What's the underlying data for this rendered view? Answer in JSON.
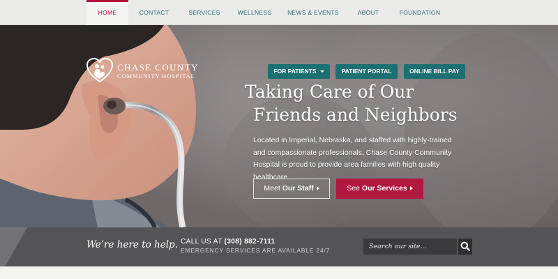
{
  "nav": {
    "items": [
      {
        "label": "HOME"
      },
      {
        "label": "CONTACT"
      },
      {
        "label": "SERVICES"
      },
      {
        "label": "WELLNESS"
      },
      {
        "label": "NEWS & EVENTS"
      },
      {
        "label": "ABOUT"
      },
      {
        "label": "FOUNDATION"
      }
    ],
    "active": "HOME"
  },
  "logo": {
    "line1": "CHASE COUNTY",
    "line2": "COMMUNITY HOSPITAL",
    "icon": "heart-family-icon"
  },
  "header_buttons": {
    "for_patients": "FOR PATIENTS",
    "patient_portal": "PATIENT PORTAL",
    "online_bill_pay": "ONLINE BILL PAY"
  },
  "hero": {
    "headline_line1": "Taking Care of Our",
    "headline_line2": "Friends and Neighbors",
    "lead": "Located in Imperial, Nebraska, and staffed with highly-trained and compassionate professionals, Chase County Community Hospital is proud to provide area families with high quality healthcare.",
    "cta_staff_prefix": "Meet ",
    "cta_staff_bold": "Our Staff",
    "cta_services_prefix": "See ",
    "cta_services_bold": "Our Services"
  },
  "helpbar": {
    "tagline": "We’re here to help.",
    "call_prefix": "CALL US AT ",
    "phone": "(308) 882-7111",
    "emergency": "EMERGENCY SERVICES ARE AVAILABLE 24/7",
    "search_placeholder": "Search our site…"
  },
  "colors": {
    "nav_text": "#2b6a6e",
    "nav_active": "#b5123f",
    "teal_button": "#1c6f72",
    "crimson_button": "#b2173f",
    "helpbar_bg": "#545355"
  }
}
